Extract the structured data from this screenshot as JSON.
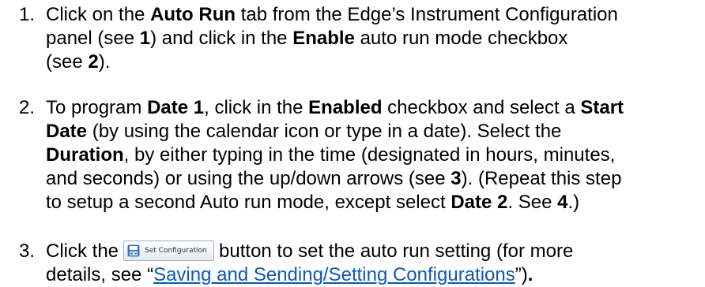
{
  "steps": [
    {
      "number": "1.",
      "segments": [
        {
          "text": "Click on the "
        },
        {
          "text": "Auto Run",
          "bold": true
        },
        {
          "text": " tab from the Edge’s Instrument Configuration"
        },
        {
          "br": true
        },
        {
          "text": "panel (see "
        },
        {
          "text": "1",
          "bold": true
        },
        {
          "text": ") and click in the "
        },
        {
          "text": "Enable",
          "bold": true
        },
        {
          "text": " auto run mode checkbox"
        },
        {
          "br": true
        },
        {
          "text": "(see "
        },
        {
          "text": "2",
          "bold": true
        },
        {
          "text": ")."
        }
      ]
    },
    {
      "number": "2.",
      "segments": [
        {
          "text": "To program "
        },
        {
          "text": "Date 1",
          "bold": true
        },
        {
          "text": ", click in the "
        },
        {
          "text": "Enabled",
          "bold": true
        },
        {
          "text": " checkbox and select a "
        },
        {
          "text": "Start",
          "bold": true
        },
        {
          "br": true
        },
        {
          "text": "Date",
          "bold": true
        },
        {
          "text": " (by using the calendar icon or type in a date). Select the"
        },
        {
          "br": true
        },
        {
          "text": "Duration",
          "bold": true
        },
        {
          "text": ", by either typing in the time (designated in hours, minutes,"
        },
        {
          "br": true
        },
        {
          "text": "and seconds) or using the up/down arrows (see "
        },
        {
          "text": "3",
          "bold": true
        },
        {
          "text": "). (Repeat this step"
        },
        {
          "br": true
        },
        {
          "text": "to setup a second Auto run mode, except select "
        },
        {
          "text": "Date 2",
          "bold": true
        },
        {
          "text": ". See "
        },
        {
          "text": "4",
          "bold": true
        },
        {
          "text": ".)"
        }
      ]
    },
    {
      "number": "3.",
      "segments": [
        {
          "text": "Click the"
        },
        {
          "button": true
        },
        {
          "text": "button to set the auto run setting (for more"
        },
        {
          "br": true
        },
        {
          "text": "details, see “"
        },
        {
          "link": "Saving and Sending/Setting Configurations"
        },
        {
          "text": "”)"
        },
        {
          "text": ".",
          "bold": true
        }
      ]
    }
  ],
  "set_configuration_button": {
    "label": "Set Configuration",
    "icon": "save-config-icon"
  }
}
